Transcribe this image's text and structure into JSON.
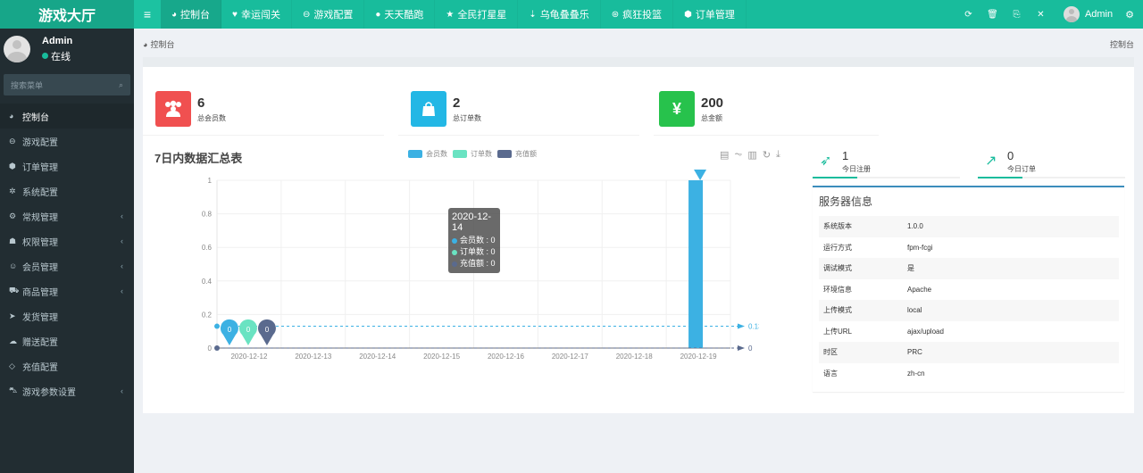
{
  "topbar": {
    "brand": "游戏大厅",
    "nav": [
      {
        "label": "控制台",
        "icon": "dashboard-icon",
        "glyph": "◕",
        "active": true
      },
      {
        "label": "幸运闯关",
        "icon": "heart-icon",
        "glyph": "♥",
        "active": false
      },
      {
        "label": "游戏配置",
        "icon": "gamepad-icon",
        "glyph": "⊖",
        "active": false
      },
      {
        "label": "天天酷跑",
        "icon": "fire-icon",
        "glyph": "●",
        "active": false
      },
      {
        "label": "全民打星星",
        "icon": "star-icon",
        "glyph": "★",
        "active": false
      },
      {
        "label": "乌龟叠叠乐",
        "icon": "sort-icon",
        "glyph": "⇣",
        "active": false
      },
      {
        "label": "疯狂投篮",
        "icon": "basketball-icon",
        "glyph": "⊛",
        "active": false
      },
      {
        "label": "订单管理",
        "icon": "cube-icon",
        "glyph": "⬢",
        "active": false
      }
    ],
    "tools": [
      {
        "name": "refresh-icon",
        "glyph": "⟳"
      },
      {
        "name": "trash-icon",
        "glyph": "🗑"
      },
      {
        "name": "language-icon",
        "glyph": "⎘"
      },
      {
        "name": "fullscreen-icon",
        "glyph": "✕"
      }
    ],
    "user": "Admin"
  },
  "sidebar": {
    "user": {
      "name": "Admin",
      "status": "在线"
    },
    "search_placeholder": "搜索菜单",
    "items": [
      {
        "label": "控制台",
        "icon": "dashboard-icon",
        "glyph": "◕",
        "active": true,
        "expandable": false
      },
      {
        "label": "游戏配置",
        "icon": "gamepad-icon",
        "glyph": "⊖",
        "active": false,
        "expandable": false
      },
      {
        "label": "订单管理",
        "icon": "cube-icon",
        "glyph": "⬢",
        "active": false,
        "expandable": false
      },
      {
        "label": "系统配置",
        "icon": "cog-icon",
        "glyph": "✲",
        "active": false,
        "expandable": false
      },
      {
        "label": "常规管理",
        "icon": "cogs-icon",
        "glyph": "⚙",
        "active": false,
        "expandable": true
      },
      {
        "label": "权限管理",
        "icon": "group-icon",
        "glyph": "☗",
        "active": false,
        "expandable": true
      },
      {
        "label": "会员管理",
        "icon": "user-circle-icon",
        "glyph": "☺",
        "active": false,
        "expandable": true
      },
      {
        "label": "商品管理",
        "icon": "cart-icon",
        "glyph": "⛟",
        "active": false,
        "expandable": true
      },
      {
        "label": "发货管理",
        "icon": "send-icon",
        "glyph": "➤",
        "active": false,
        "expandable": false
      },
      {
        "label": "赠送配置",
        "icon": "cloud-upload-icon",
        "glyph": "☁",
        "active": false,
        "expandable": false
      },
      {
        "label": "充值配置",
        "icon": "diamond-icon",
        "glyph": "◇",
        "active": false,
        "expandable": false
      },
      {
        "label": "游戏参数设置",
        "icon": "car-icon",
        "glyph": "⛍",
        "active": false,
        "expandable": true
      }
    ]
  },
  "breadcrumb": {
    "left": "控制台",
    "right": "控制台"
  },
  "stats": [
    {
      "value": "6",
      "label": "总会员数",
      "color": "#f05050",
      "icon": "users-icon",
      "glyph": "👥"
    },
    {
      "value": "2",
      "label": "总订单数",
      "color": "#23b7e5",
      "icon": "shopping-bag-icon",
      "glyph": "👜"
    },
    {
      "value": "200",
      "label": "总金额",
      "color": "#27c24c",
      "icon": "yen-icon",
      "glyph": "¥"
    }
  ],
  "mini_stats": [
    {
      "value": "1",
      "label": "今日注册",
      "icon": "rocket-icon",
      "glyph": "🚀"
    },
    {
      "value": "0",
      "label": "今日订单",
      "icon": "line-chart-icon",
      "glyph": "📈"
    }
  ],
  "server": {
    "title": "服务器信息",
    "rows": [
      {
        "k": "系统版本",
        "v": "1.0.0"
      },
      {
        "k": "运行方式",
        "v": "fpm-fcgi"
      },
      {
        "k": "调试模式",
        "v": "是"
      },
      {
        "k": "环境信息",
        "v": "Apache"
      },
      {
        "k": "上传模式",
        "v": "local"
      },
      {
        "k": "上传URL",
        "v": "ajax/upload"
      },
      {
        "k": "时区",
        "v": "PRC"
      },
      {
        "k": "语言",
        "v": "zh-cn"
      }
    ]
  },
  "tooltip": {
    "date": "2020-12-14",
    "rows": [
      "会员数 : 0",
      "订单数 : 0",
      "充值额 : 0"
    ]
  },
  "chart_data": {
    "type": "bar",
    "title": "7日内数据汇总表",
    "categories": [
      "2020-12-12",
      "2020-12-13",
      "2020-12-14",
      "2020-12-15",
      "2020-12-16",
      "2020-12-17",
      "2020-12-18",
      "2020-12-19"
    ],
    "series": [
      {
        "name": "会员数",
        "color": "#3cb1e3",
        "values": [
          0,
          0,
          0,
          0,
          0,
          0,
          0,
          1
        ]
      },
      {
        "name": "订单数",
        "color": "#6ae3c2",
        "values": [
          0,
          0,
          0,
          0,
          0,
          0,
          0,
          0
        ]
      },
      {
        "name": "充值额",
        "color": "#5a6a8e",
        "values": [
          0,
          0,
          0,
          0,
          0,
          0,
          0,
          0
        ]
      }
    ],
    "mark_points": [
      {
        "series": 0,
        "label": "0",
        "type": "min",
        "category": "2020-12-12"
      },
      {
        "series": 1,
        "label": "0",
        "type": "min",
        "category": "2020-12-12"
      },
      {
        "series": 2,
        "label": "0",
        "type": "min",
        "category": "2020-12-12"
      },
      {
        "series": 0,
        "label": "1",
        "type": "max",
        "category": "2020-12-19"
      }
    ],
    "mark_lines": [
      {
        "series": 0,
        "value": 0.13,
        "label": "0.13"
      },
      {
        "series": 2,
        "value": 0,
        "label": "0"
      }
    ],
    "yticks": [
      "0",
      "0.2",
      "0.4",
      "0.6",
      "0.8",
      "1"
    ],
    "ylim": [
      0,
      1
    ],
    "grid": true,
    "legend": "top-center",
    "xlabel": "",
    "ylabel": ""
  }
}
